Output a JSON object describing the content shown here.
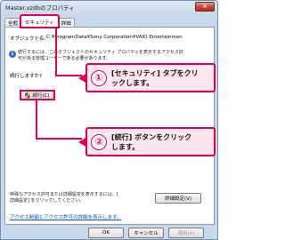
{
  "window": {
    "title": "Master.vzdbのプロパティ",
    "close_label": "×"
  },
  "tabs": [
    {
      "label": "全般",
      "active": false
    },
    {
      "label": "セキュリティ",
      "active": true
    },
    {
      "label": "詳細",
      "active": false
    }
  ],
  "security": {
    "object_name_label": "オブジェクト名:",
    "object_name_value": "C:¥ProgramData¥Sony Corporation¥VAIO Entertainmen",
    "info_line1": "続行するには、このオブジェクトのセキュリティ プロパティを表示するアクセス許",
    "info_line2": "可がある管理ユーザーである必要があります。",
    "continue_question": "続行しますか?",
    "continue_button": "続行(C)",
    "special_text_line1": "特殊なアクセス許可または詳細設定を表示するには、[",
    "special_text_line2": "詳細設定] をクリックしてください。",
    "advanced_button": "詳細設定(V)",
    "link_text": "アクセス制御とアクセス許可の詳細を表示します。"
  },
  "footer": {
    "ok": "OK",
    "cancel": "キャンセル",
    "apply": "適用(A)"
  },
  "callouts": [
    {
      "number": "①",
      "line1": "[セキュリティ] タブをクリ",
      "line2": "ックします。"
    },
    {
      "number": "②",
      "line1": "[続行] ボタンをクリック",
      "line2": "します。"
    }
  ],
  "colors": {
    "accent": "#e5004f",
    "callout_bg": "#fde6ef",
    "link": "#0654c2"
  }
}
